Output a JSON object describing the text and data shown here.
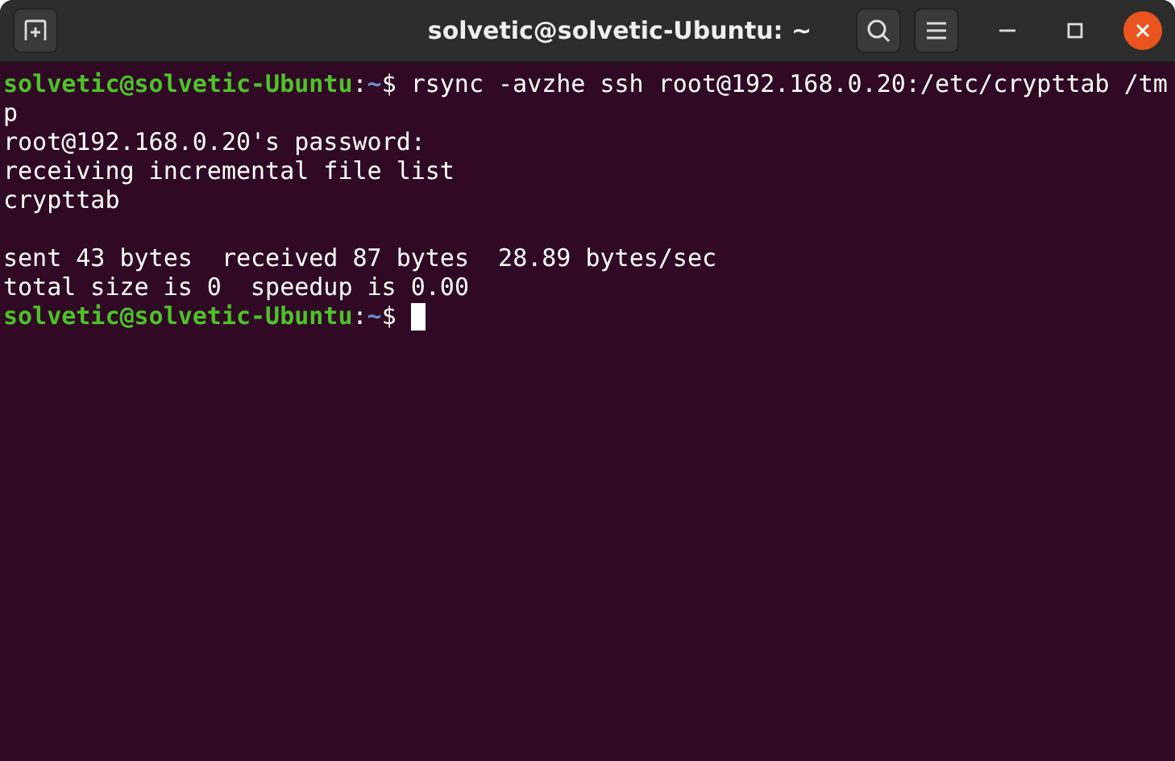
{
  "window": {
    "title": "solvetic@solvetic-Ubuntu: ~"
  },
  "terminal": {
    "lines": [
      {
        "kind": "prompt",
        "user": "solvetic@solvetic-Ubuntu",
        "separator": ":",
        "path": "~",
        "symbol": "$",
        "command": "rsync -avzhe ssh root@192.168.0.20:/etc/crypttab /tm"
      },
      {
        "kind": "output",
        "text": "p"
      },
      {
        "kind": "output",
        "text": "root@192.168.0.20's password:"
      },
      {
        "kind": "output",
        "text": "receiving incremental file list"
      },
      {
        "kind": "output",
        "text": "crypttab"
      },
      {
        "kind": "blank"
      },
      {
        "kind": "output",
        "text": "sent 43 bytes  received 87 bytes  28.89 bytes/sec"
      },
      {
        "kind": "output",
        "text": "total size is 0  speedup is 0.00"
      },
      {
        "kind": "prompt",
        "user": "solvetic@solvetic-Ubuntu",
        "separator": ":",
        "path": "~",
        "symbol": "$",
        "cursor": true
      }
    ]
  }
}
